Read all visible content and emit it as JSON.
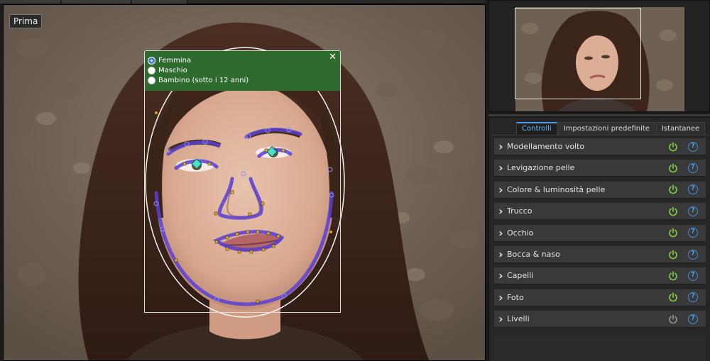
{
  "canvas": {
    "before_button": "Prima"
  },
  "gender_panel": {
    "options": [
      {
        "label": "Femmina",
        "selected": true
      },
      {
        "label": "Maschio",
        "selected": false
      },
      {
        "label": "Bambino (sotto i 12 anni)",
        "selected": false
      }
    ],
    "close_label": "✕"
  },
  "tabs": [
    {
      "label": "Controlli",
      "active": true
    },
    {
      "label": "Impostazioni predefinite",
      "active": false
    },
    {
      "label": "Istantanee",
      "active": false
    }
  ],
  "controls": [
    {
      "label": "Modellamento volto",
      "enabled": true
    },
    {
      "label": "Levigazione pelle",
      "enabled": true
    },
    {
      "label": "Colore & luminosità pelle",
      "enabled": true
    },
    {
      "label": "Trucco",
      "enabled": true
    },
    {
      "label": "Occhio",
      "enabled": true
    },
    {
      "label": "Bocca & naso",
      "enabled": true
    },
    {
      "label": "Capelli",
      "enabled": true
    },
    {
      "label": "Foto",
      "enabled": true
    },
    {
      "label": "Livelli",
      "enabled": false
    }
  ],
  "colors": {
    "power_on": "#7ac143",
    "power_off": "#8a8a8a",
    "accent": "#4da3f0",
    "panel_green": "#2f6b2e",
    "contour_purple": "#5a3fd6"
  },
  "icons": {
    "chevron": "chevron-right-icon",
    "power": "power-icon",
    "help": "help-icon"
  }
}
